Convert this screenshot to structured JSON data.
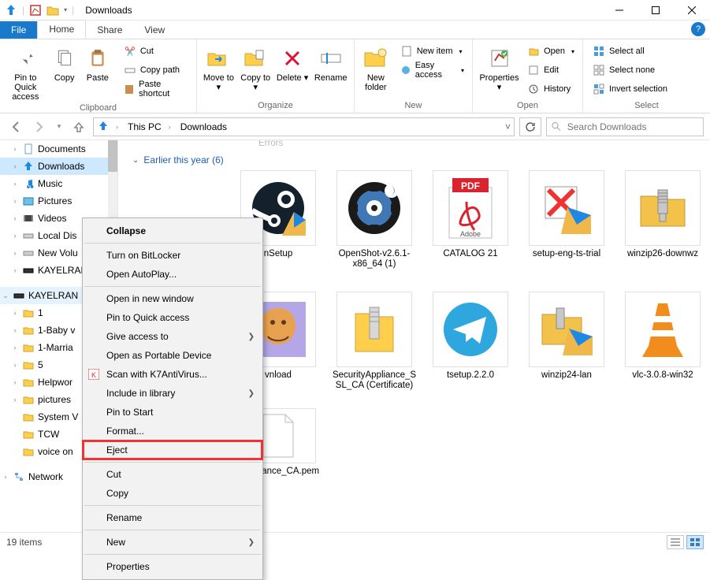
{
  "window": {
    "title": "Downloads"
  },
  "tabs": {
    "file": "File",
    "home": "Home",
    "share": "Share",
    "view": "View"
  },
  "ribbon": {
    "clipboard": {
      "label": "Clipboard",
      "pin": "Pin to Quick access",
      "copy": "Copy",
      "paste": "Paste",
      "cut": "Cut",
      "copypath": "Copy path",
      "pastesc": "Paste shortcut"
    },
    "organize": {
      "label": "Organize",
      "moveto": "Move to",
      "copyto": "Copy to",
      "delete": "Delete",
      "rename": "Rename"
    },
    "new": {
      "label": "New",
      "newfolder": "New folder",
      "newitem": "New item",
      "easyaccess": "Easy access"
    },
    "open": {
      "label": "Open",
      "properties": "Properties",
      "open": "Open",
      "edit": "Edit",
      "history": "History"
    },
    "select": {
      "label": "Select",
      "all": "Select all",
      "none": "Select none",
      "invert": "Invert selection"
    }
  },
  "breadcrumb": {
    "root": "This PC",
    "folder": "Downloads"
  },
  "search": {
    "placeholder": "Search Downloads"
  },
  "tree": {
    "documents": "Documents",
    "downloads": "Downloads",
    "music": "Music",
    "pictures": "Pictures",
    "videos": "Videos",
    "localdisk": "Local Dis",
    "newvol": "New Volu",
    "kayel1": "KAYELRAN",
    "kayel2": "KAYELRAN",
    "f1": "1",
    "f2": "1-Baby v",
    "f3": "1-Marria",
    "f4": "5",
    "f5": "Helpwor",
    "f6": "pictures",
    "f7": "System V",
    "f8": "TCW",
    "f9": "voice on",
    "network": "Network"
  },
  "content": {
    "truncated_above": "Errors",
    "group_header": "Earlier this year (6)",
    "row1": [
      {
        "id": "nsetup",
        "caption": "nSetup"
      },
      {
        "id": "openshot",
        "caption": "OpenShot-v2.6.1-x86_64 (1)"
      },
      {
        "id": "catalog",
        "caption": "CATALOG 21"
      },
      {
        "id": "setupeng",
        "caption": "setup-eng-ts-trial"
      },
      {
        "id": "winzip26",
        "caption": "winzip26-downwz"
      }
    ],
    "row2": [
      {
        "id": "vnload",
        "caption": "vnload"
      },
      {
        "id": "secapp",
        "caption": "SecurityAppliance_SSL_CA (Certificate)"
      },
      {
        "id": "tsetup",
        "caption": "tsetup.2.2.0"
      },
      {
        "id": "winzip24",
        "caption": "winzip24-lan"
      },
      {
        "id": "vlc",
        "caption": "vlc-3.0.8-win32"
      }
    ],
    "row3": [
      {
        "id": "pem",
        "caption": "yAppliance_CA.pem"
      }
    ]
  },
  "context_menu": {
    "collapse": "Collapse",
    "bitlocker": "Turn on BitLocker",
    "autoplay": "Open AutoPlay...",
    "newwin": "Open in new window",
    "pinquick": "Pin to Quick access",
    "giveaccess": "Give access to",
    "portable": "Open as Portable Device",
    "k7": "Scan with K7AntiVirus...",
    "library": "Include in library",
    "pinstart": "Pin to Start",
    "format": "Format...",
    "eject": "Eject",
    "cut": "Cut",
    "copy": "Copy",
    "rename": "Rename",
    "new": "New",
    "properties": "Properties"
  },
  "status": {
    "items": "19 items"
  }
}
